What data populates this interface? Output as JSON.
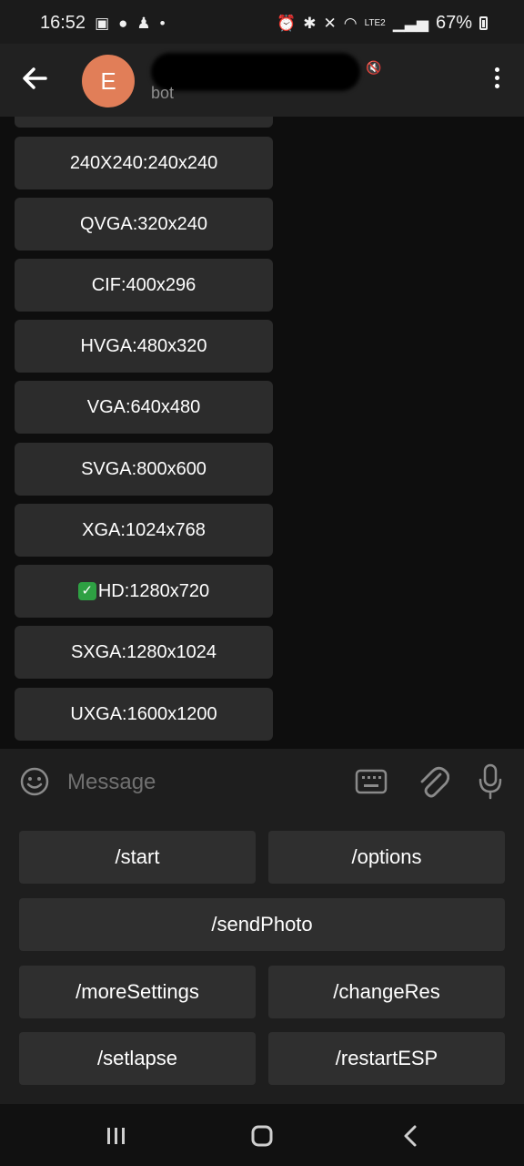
{
  "status_bar": {
    "time": "16:52",
    "battery": "67%",
    "network": "LTE2"
  },
  "header": {
    "avatar_letter": "E",
    "subtitle": "bot"
  },
  "inline_keyboard": [
    {
      "label": "240X240:240x240"
    },
    {
      "label": "QVGA:320x240"
    },
    {
      "label": "CIF:400x296"
    },
    {
      "label": "HVGA:480x320"
    },
    {
      "label": "VGA:640x480"
    },
    {
      "label": "SVGA:800x600"
    },
    {
      "label": "XGA:1024x768"
    },
    {
      "label": "HD:1280x720",
      "checked": true
    },
    {
      "label": "SXGA:1280x1024"
    },
    {
      "label": "UXGA:1600x1200"
    }
  ],
  "composer": {
    "placeholder": "Message"
  },
  "reply_keyboard": {
    "start": "/start",
    "options": "/options",
    "sendPhoto": "/sendPhoto",
    "moreSettings": "/moreSettings",
    "changeRes": "/changeRes",
    "setlapse": "/setlapse",
    "restartESP": "/restartESP"
  },
  "colors": {
    "avatar": "#e17e58",
    "check": "#2ea043",
    "button_bg": "#2c2c2c"
  }
}
